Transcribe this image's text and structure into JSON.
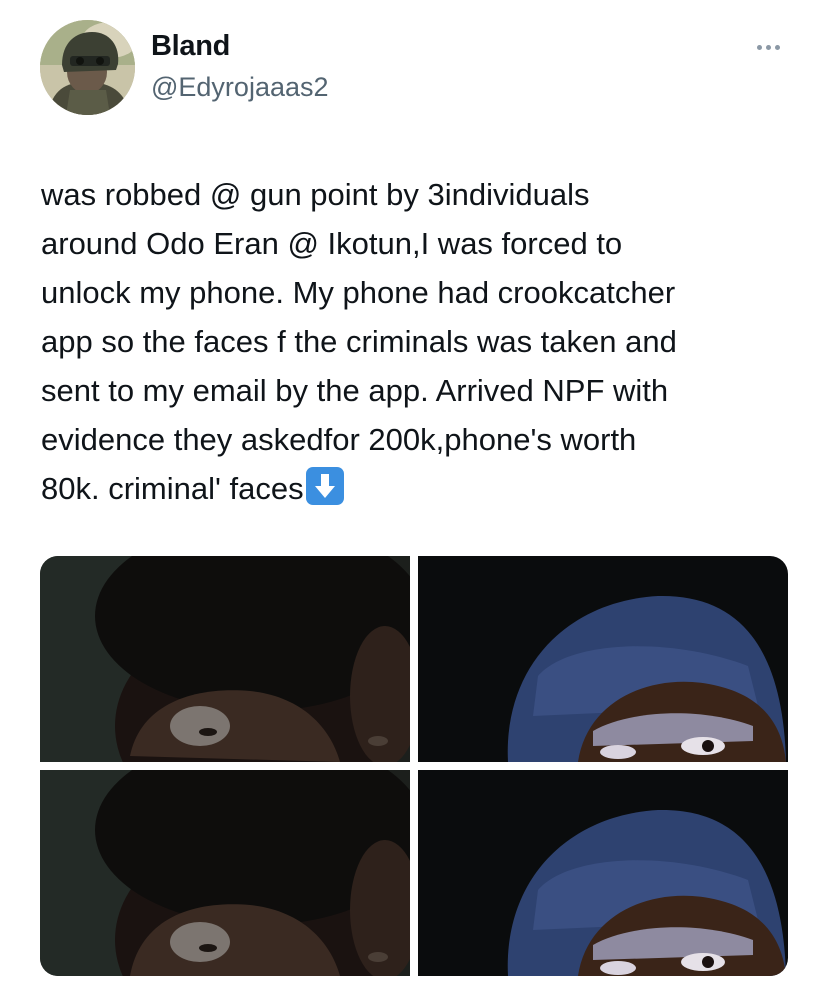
{
  "author": {
    "display_name": "Bland",
    "handle": "@Edyrojaaas2",
    "avatar_icon": "helmet-soldier-avatar"
  },
  "more_icon": "more-horizontal-icon",
  "tweet": {
    "text": "was robbed @ gun point by 3individuals\naround Odo Eran @ Ikotun,I was forced to\nunlock my phone. My phone had crookcatcher\napp so the faces f the criminals was taken and\nsent to my email by the app. Arrived NPF with\nevidence they askedfor 200k,phone's worth\n80k. criminal' faces",
    "trailing_emoji": "down-arrow-emoji"
  },
  "media": {
    "photos": [
      {
        "name": "criminal-face-photo-1",
        "subject": "man with dark cap"
      },
      {
        "name": "criminal-face-photo-2",
        "subject": "man with blue cap"
      },
      {
        "name": "criminal-face-photo-3",
        "subject": "man with dark cap"
      },
      {
        "name": "criminal-face-photo-4",
        "subject": "man with blue cap"
      }
    ]
  },
  "colors": {
    "text": "#0f1419",
    "secondary_text": "#536471",
    "emoji_blue": "#3b8fe0",
    "cap_blue": "#2e4270"
  }
}
